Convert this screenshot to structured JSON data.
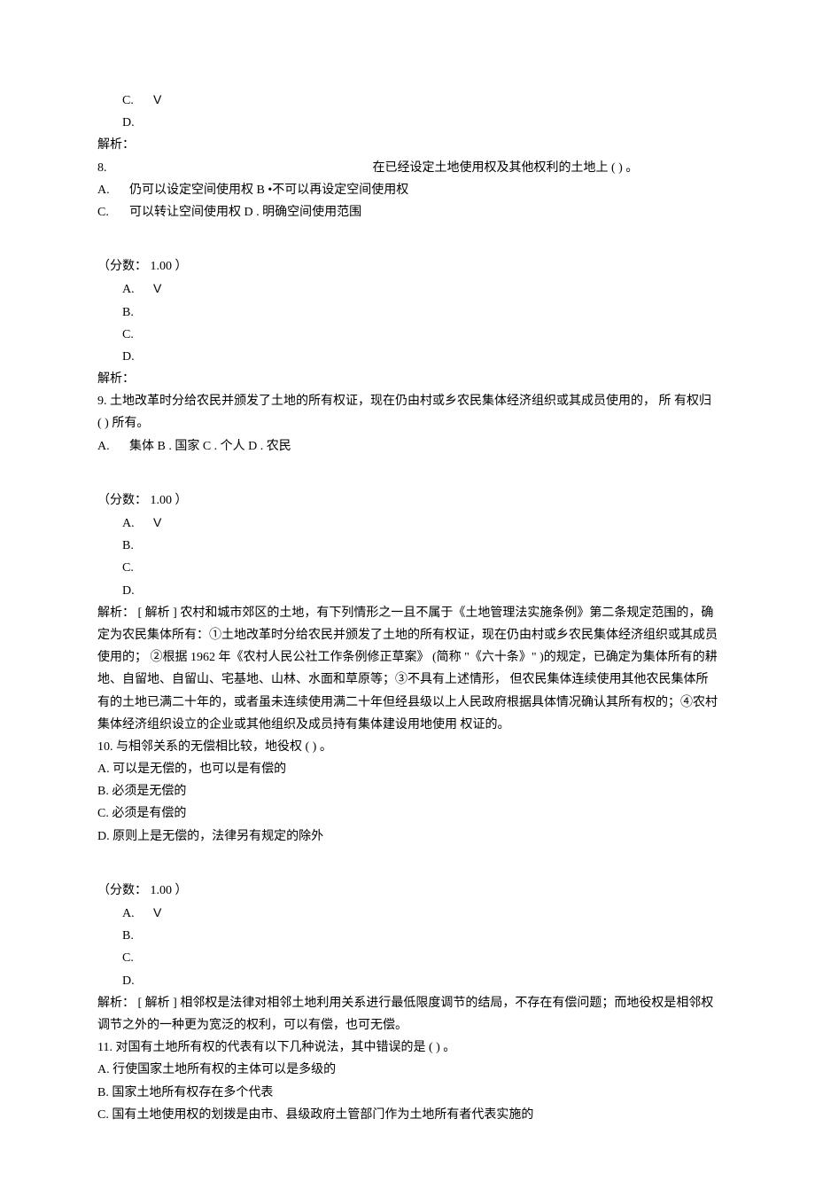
{
  "answers_prefix_block": {
    "c": "C.",
    "d": "D.",
    "analysis_label": "解析：",
    "check": "V"
  },
  "q8": {
    "num": "8.",
    "stem_lead_spacer": "",
    "stem": "在已经设定土地使用权及其他权利的土地上  ( ) 。",
    "optA_letter": "A.",
    "optA_text": "仍可以设定空间使用权  B •不可以再设定空间使用权",
    "optC_letter": "C.",
    "optC_text": "可以转让空间使用权  D . 明确空间使用范围",
    "score": "（分数：  1.00 ）",
    "ans_a": "A.",
    "ans_b": "B.",
    "ans_c": "C.",
    "ans_d": "D.",
    "check": "V",
    "analysis_label": "解析："
  },
  "q9": {
    "num_stem": "9.  土地改革时分给农民并颁发了土地的所有权证，现在仍由村或乡农民集体经济组织或其成员使用的， 所  有权归  ( ) 所有。",
    "optA_letter": "A.",
    "optA_text": "集体 B . 国家 C . 个人 D . 农民",
    "score": "（分数：  1.00 ）",
    "ans_a": "A.",
    "ans_b": "B.",
    "ans_c": "C.",
    "ans_d": "D.",
    "check": "V",
    "analysis": "解析：  [ 解析 ] 农村和城市郊区的土地，有下列情形之一且不属于《土地管理法实施条例》第二条规定范围的，确定为农民集体所有：①土地改革时分给农民并颁发了土地的所有权证，现在仍由村或乡农民集体经济组织或其成员使用的；  ②根据  1962 年《农村人民公社工作条例修正草案》  (简称 \"《六十条》\" )的规定，已确定为集体所有的耕地、自留地、自留山、宅基地、山林、水面和草原等；③不具有上述情形， 但农民集体连续使用其他农民集体所有的土地已满二十年的，或者虽未连续使用满二十年但经县级以上人民政府根据具体情况确认其所有权的；④农村集体经济组织设立的企业或其他组织及成员持有集体建设用地使用  权证的。"
  },
  "q10": {
    "num_stem": "10.  与相邻关系的无偿相比较，地役权  ( ) 。",
    "optA": "A.  可以是无偿的，也可以是有偿的",
    "optB": "B.  必须是无偿的",
    "optC": "C.  必须是有偿的",
    "optD": "D.  原则上是无偿的，法律另有规定的除外",
    "score": "（分数：  1.00 ）",
    "ans_a": "A.",
    "ans_b": "B.",
    "ans_c": "C.",
    "ans_d": "D.",
    "check": "V",
    "analysis": "解析：  [ 解析 ] 相邻权是法律对相邻土地利用关系进行最低限度调节的结局，不存在有偿问题；而地役权是相邻权调节之外的一种更为宽泛的权利，可以有偿，也可无偿。"
  },
  "q11": {
    "num_stem": "11.  对国有土地所有权的代表有以下几种说法，其中错误的是  ( ) 。",
    "optA": "A.  行使国家土地所有权的主体可以是多级的",
    "optB": "B.  国家土地所有权存在多个代表",
    "optC": "C.  国有土地使用权的划拨是由市、县级政府土管部门作为土地所有者代表实施的"
  }
}
